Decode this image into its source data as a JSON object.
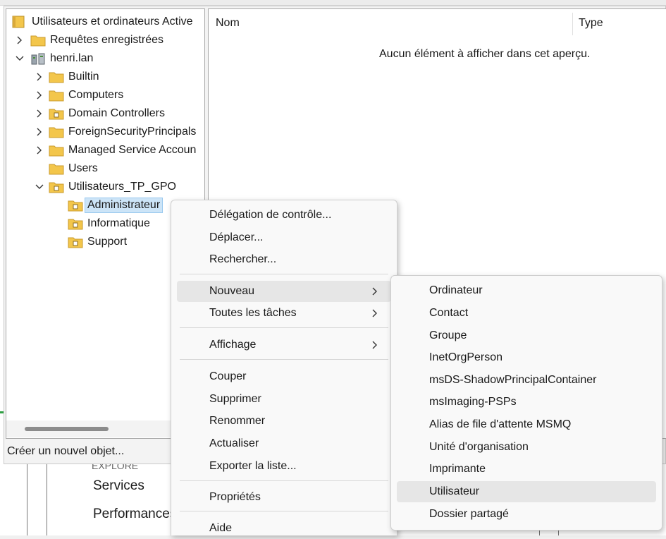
{
  "background_window": {
    "partial_label": "EXPLORE",
    "items": [
      "Services",
      "Performances"
    ]
  },
  "tree": {
    "root": "Utilisateurs et ordinateurs Active",
    "saved_queries": "Requêtes enregistrées",
    "domain": "henri.lan",
    "children": [
      "Builtin",
      "Computers",
      "Domain Controllers",
      "ForeignSecurityPrincipals",
      "Managed Service Accoun",
      "Users",
      "Utilisateurs_TP_GPO"
    ],
    "ou_children": [
      "Administrateur",
      "Informatique",
      "Support"
    ]
  },
  "list": {
    "col_name": "Nom",
    "col_type": "Type",
    "empty_message": "Aucun élément à afficher dans cet aperçu."
  },
  "status_text": "Créer un nouvel objet...",
  "context_menu": {
    "items": [
      "Délégation de contrôle...",
      "Déplacer...",
      "Rechercher...",
      "Nouveau",
      "Toutes les tâches",
      "Affichage",
      "Couper",
      "Supprimer",
      "Renommer",
      "Actualiser",
      "Exporter la liste...",
      "Propriétés",
      "Aide"
    ]
  },
  "submenu_nouveau": {
    "items": [
      "Ordinateur",
      "Contact",
      "Groupe",
      "InetOrgPerson",
      "msDS-ShadowPrincipalContainer",
      "msImaging-PSPs",
      "Alias de file d'attente MSMQ",
      "Unité d'organisation",
      "Imprimante",
      "Utilisateur",
      "Dossier partagé"
    ]
  },
  "colors": {
    "folder_yellow": "#f3c64b",
    "selection": "#cce4f7",
    "menu_highlight": "#e6e6e6"
  }
}
